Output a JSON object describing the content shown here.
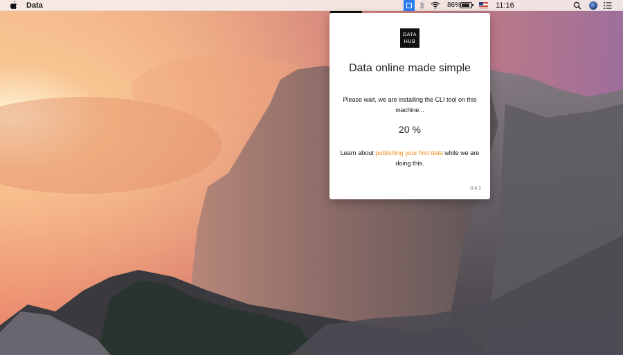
{
  "menubar": {
    "app_name": "Data",
    "battery_percent": "86%",
    "battery_level": 0.86,
    "clock": "11:16"
  },
  "popup": {
    "logo_line1": "DATA",
    "logo_line2": "HUB",
    "headline": "Data online made simple",
    "wait_message": "Please wait, we are installing the CLI tool on this machine...",
    "progress": "20 %",
    "learn_prefix": "Learn about ",
    "learn_link": "publishing your first data",
    "learn_suffix": " while we are doing this.",
    "version": "0.4.1"
  },
  "colors": {
    "accent_link": "#f08a1a",
    "tray_active": "#2b7cf0"
  },
  "icons": [
    "apple-icon",
    "app-tray-icon",
    "bluetooth-icon",
    "wifi-icon",
    "battery-icon",
    "us-flag-icon",
    "spotlight-search-icon",
    "siri-icon",
    "notification-center-icon"
  ]
}
